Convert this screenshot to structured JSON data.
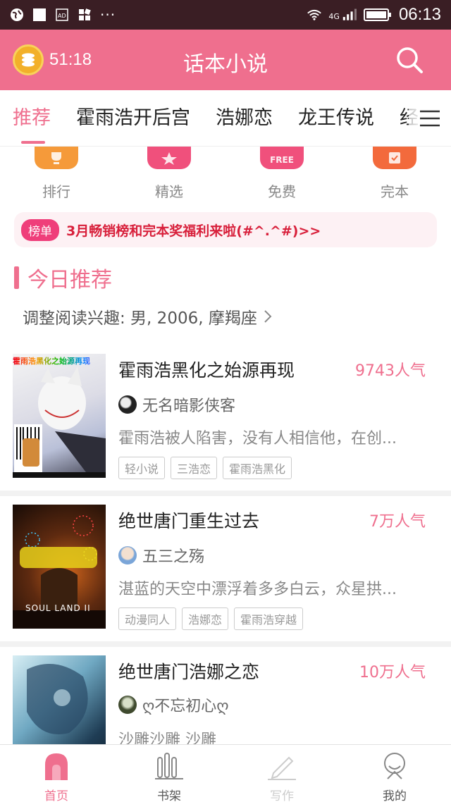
{
  "status_bar": {
    "time": "06:13",
    "network": "4G",
    "more": "···"
  },
  "header": {
    "timer": "51:18",
    "title": "话本小说"
  },
  "tabs": [
    {
      "label": "推荐",
      "active": true
    },
    {
      "label": "霍雨浩开后宫"
    },
    {
      "label": "浩娜恋"
    },
    {
      "label": "龙王传说"
    },
    {
      "label": "经"
    }
  ],
  "quick_entries": [
    {
      "label": "排行",
      "color": "#f59a3a",
      "icon": "trophy-icon"
    },
    {
      "label": "精选",
      "color": "#f0507c",
      "icon": "star-icon"
    },
    {
      "label": "免费",
      "color": "#f0507c",
      "icon": "free-icon",
      "badge": "FREE"
    },
    {
      "label": "完本",
      "color": "#f36a3c",
      "icon": "check-icon"
    }
  ],
  "notice": {
    "badge": "榜单",
    "text": "3月畅销榜和完本奖福利来啦(#^.^#)>>"
  },
  "section": {
    "title": "今日推荐",
    "interest": "调整阅读兴趣: 男, 2006, 摩羯座"
  },
  "books": [
    {
      "title": "霍雨浩黑化之始源再现",
      "popularity": "9743人气",
      "author": "无名暗影侠客",
      "desc": "霍雨浩被人陷害，没有人相信他，在创...",
      "tags": [
        "轻小说",
        "三浩恋",
        "霍雨浩黑化"
      ],
      "cover_text": "霍雨浩黑化之始源再现"
    },
    {
      "title": "绝世唐门重生过去",
      "popularity": "7万人气",
      "author": "五三之殇",
      "desc": "湛蓝的天空中漂浮着多多白云，众星拱...",
      "tags": [
        "动漫同人",
        "浩娜恋",
        "霍雨浩穿越"
      ],
      "cover_text": "SOUL LAND II"
    },
    {
      "title": "绝世唐门浩娜之恋",
      "popularity": "10万人气",
      "author": "ღ不忘初心ღ",
      "desc": "沙雕沙雕 沙雕",
      "tags": [],
      "cover_text": ""
    }
  ],
  "bottom_nav": [
    {
      "label": "首页",
      "icon": "home-icon",
      "active": true
    },
    {
      "label": "书架",
      "icon": "bookshelf-icon"
    },
    {
      "label": "写作",
      "icon": "pen-icon",
      "disabled": true
    },
    {
      "label": "我的",
      "icon": "profile-icon"
    }
  ],
  "colors": {
    "primary": "#ef6f8e",
    "status_bar": "#3a1e24",
    "notice_text": "#d8203b"
  }
}
